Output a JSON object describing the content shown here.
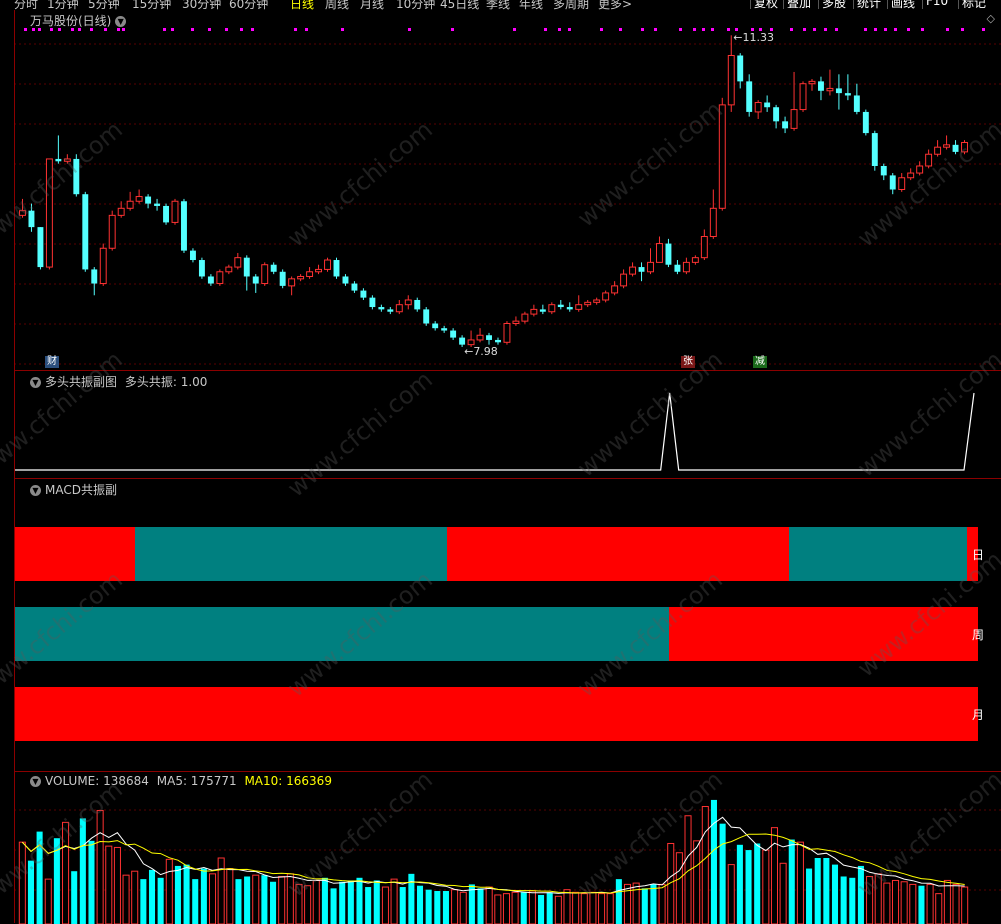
{
  "toolbar": {
    "tabs": [
      {
        "label": "分时",
        "active": false
      },
      {
        "label": "1分钟",
        "active": false
      },
      {
        "label": "5分钟",
        "active": false
      },
      {
        "label": "15分钟",
        "active": false
      },
      {
        "label": "30分钟",
        "active": false
      },
      {
        "label": "60分钟",
        "active": false
      },
      {
        "label": "日线",
        "active": true
      },
      {
        "label": "周线",
        "active": false
      },
      {
        "label": "月线",
        "active": false
      },
      {
        "label": "10分钟",
        "active": false
      },
      {
        "label": "45日线",
        "active": false
      },
      {
        "label": "季线",
        "active": false
      },
      {
        "label": "年线",
        "active": false
      },
      {
        "label": "多周期",
        "active": false
      },
      {
        "label": "更多>",
        "active": false
      }
    ],
    "right_buttons": [
      "复权",
      "叠加",
      "多股",
      "统计",
      "画线",
      "F10",
      "标记"
    ]
  },
  "main_chart": {
    "title": "万马股份(日线)",
    "high_label": "11.33",
    "low_label": "7.98",
    "markers": {
      "cai": "财",
      "zhang": "张",
      "jian": "减"
    },
    "colors": {
      "up": "#ff3232",
      "down": "#54ffff"
    },
    "candles": [
      [
        7.5,
        7.6,
        7.85,
        7.45
      ],
      [
        7.6,
        7.25,
        7.75,
        7.15
      ],
      [
        7.25,
        6.4,
        7.25,
        6.35
      ],
      [
        6.4,
        8.7,
        8.7,
        6.35
      ],
      [
        8.7,
        8.65,
        9.2,
        8.6
      ],
      [
        8.65,
        8.7,
        8.8,
        8.6
      ],
      [
        8.7,
        7.95,
        8.8,
        7.9
      ],
      [
        7.95,
        6.35,
        8.0,
        6.3
      ],
      [
        6.35,
        6.05,
        6.4,
        5.8
      ],
      [
        6.05,
        6.8,
        6.9,
        6.0
      ],
      [
        6.8,
        7.5,
        7.6,
        6.75
      ],
      [
        7.5,
        7.65,
        7.8,
        7.45
      ],
      [
        7.65,
        7.8,
        8.0,
        7.6
      ],
      [
        7.8,
        7.9,
        8.05,
        7.75
      ],
      [
        7.9,
        7.75,
        7.95,
        7.65
      ],
      [
        7.75,
        7.7,
        7.85,
        7.6
      ],
      [
        7.7,
        7.35,
        7.75,
        7.3
      ],
      [
        7.35,
        7.8,
        7.85,
        7.3
      ],
      [
        7.8,
        6.75,
        7.85,
        6.7
      ],
      [
        6.75,
        6.55,
        6.8,
        6.5
      ],
      [
        6.55,
        6.2,
        6.6,
        6.15
      ],
      [
        6.2,
        6.05,
        6.25,
        6.0
      ],
      [
        6.05,
        6.3,
        6.35,
        6.0
      ],
      [
        6.3,
        6.4,
        6.45,
        6.25
      ],
      [
        6.4,
        6.6,
        6.7,
        6.35
      ],
      [
        6.6,
        6.2,
        6.65,
        5.9
      ],
      [
        6.2,
        6.05,
        6.25,
        5.85
      ],
      [
        6.05,
        6.45,
        6.5,
        6.0
      ],
      [
        6.45,
        6.3,
        6.5,
        6.25
      ],
      [
        6.3,
        6.0,
        6.35,
        5.95
      ],
      [
        6.0,
        6.15,
        6.2,
        5.8
      ],
      [
        6.15,
        6.2,
        6.25,
        6.1
      ],
      [
        6.2,
        6.3,
        6.4,
        6.15
      ],
      [
        6.3,
        6.35,
        6.45,
        6.25
      ],
      [
        6.35,
        6.55,
        6.6,
        6.3
      ],
      [
        6.55,
        6.2,
        6.6,
        6.15
      ],
      [
        6.2,
        6.05,
        6.25,
        6.0
      ],
      [
        6.05,
        5.9,
        6.1,
        5.85
      ],
      [
        5.9,
        5.75,
        5.95,
        5.7
      ],
      [
        5.75,
        5.55,
        5.8,
        5.5
      ],
      [
        5.55,
        5.5,
        5.6,
        5.45
      ],
      [
        5.5,
        5.45,
        5.55,
        5.4
      ],
      [
        5.45,
        5.6,
        5.7,
        5.4
      ],
      [
        5.6,
        5.7,
        5.8,
        5.5
      ],
      [
        5.7,
        5.5,
        5.75,
        5.45
      ],
      [
        5.5,
        5.2,
        5.55,
        5.15
      ],
      [
        5.2,
        5.1,
        5.25,
        5.05
      ],
      [
        5.1,
        5.05,
        5.15,
        5.0
      ],
      [
        5.05,
        4.9,
        5.1,
        4.85
      ],
      [
        4.9,
        4.75,
        4.95,
        4.7
      ],
      [
        4.75,
        4.85,
        5.05,
        4.7
      ],
      [
        4.85,
        4.95,
        5.1,
        4.8
      ],
      [
        4.95,
        4.85,
        5.0,
        4.75
      ],
      [
        4.85,
        4.8,
        4.9,
        4.75
      ],
      [
        4.8,
        5.2,
        5.25,
        4.75
      ],
      [
        5.2,
        5.25,
        5.35,
        5.15
      ],
      [
        5.25,
        5.4,
        5.45,
        5.2
      ],
      [
        5.4,
        5.5,
        5.6,
        5.35
      ],
      [
        5.5,
        5.45,
        5.6,
        5.4
      ],
      [
        5.45,
        5.6,
        5.65,
        5.4
      ],
      [
        5.6,
        5.55,
        5.7,
        5.5
      ],
      [
        5.55,
        5.5,
        5.65,
        5.45
      ],
      [
        5.5,
        5.6,
        5.8,
        5.45
      ],
      [
        5.6,
        5.65,
        5.7,
        5.55
      ],
      [
        5.65,
        5.7,
        5.75,
        5.6
      ],
      [
        5.7,
        5.85,
        5.9,
        5.65
      ],
      [
        5.85,
        6.0,
        6.1,
        5.8
      ],
      [
        6.0,
        6.25,
        6.35,
        5.95
      ],
      [
        6.25,
        6.4,
        6.5,
        6.2
      ],
      [
        6.4,
        6.3,
        6.5,
        6.1
      ],
      [
        6.3,
        6.5,
        6.8,
        6.25
      ],
      [
        6.5,
        6.9,
        7.05,
        6.5
      ],
      [
        6.9,
        6.45,
        7.0,
        6.4
      ],
      [
        6.45,
        6.3,
        6.55,
        6.25
      ],
      [
        6.3,
        6.5,
        6.6,
        6.25
      ],
      [
        6.5,
        6.6,
        6.65,
        6.45
      ],
      [
        6.6,
        7.05,
        7.2,
        6.55
      ],
      [
        7.05,
        7.65,
        8.05,
        7.0
      ],
      [
        7.65,
        9.85,
        10.0,
        7.6
      ],
      [
        9.85,
        10.9,
        11.33,
        9.7
      ],
      [
        10.9,
        10.35,
        10.95,
        10.2
      ],
      [
        10.35,
        9.7,
        10.5,
        9.6
      ],
      [
        9.7,
        9.9,
        9.95,
        9.55
      ],
      [
        9.9,
        9.8,
        10.05,
        9.7
      ],
      [
        9.8,
        9.5,
        9.85,
        9.35
      ],
      [
        9.5,
        9.35,
        9.6,
        9.25
      ],
      [
        9.35,
        9.75,
        10.55,
        9.3
      ],
      [
        9.75,
        10.3,
        10.35,
        9.7
      ],
      [
        10.3,
        10.35,
        10.4,
        10.15
      ],
      [
        10.35,
        10.15,
        10.45,
        9.95
      ],
      [
        10.15,
        10.2,
        10.6,
        10.05
      ],
      [
        10.2,
        10.1,
        10.5,
        9.75
      ],
      [
        10.1,
        10.05,
        10.5,
        9.95
      ],
      [
        10.05,
        9.7,
        10.3,
        9.65
      ],
      [
        9.7,
        9.25,
        9.75,
        9.2
      ],
      [
        9.25,
        8.55,
        9.3,
        8.45
      ],
      [
        8.55,
        8.35,
        8.6,
        8.25
      ],
      [
        8.35,
        8.05,
        8.4,
        7.95
      ],
      [
        8.05,
        8.3,
        8.4,
        8.0
      ],
      [
        8.3,
        8.4,
        8.5,
        8.25
      ],
      [
        8.4,
        8.55,
        8.65,
        8.35
      ],
      [
        8.55,
        8.8,
        8.9,
        8.5
      ],
      [
        8.8,
        8.95,
        9.1,
        8.75
      ],
      [
        8.95,
        9.0,
        9.2,
        8.9
      ],
      [
        9.0,
        8.85,
        9.1,
        8.8
      ],
      [
        8.85,
        9.05,
        9.1,
        8.8
      ]
    ]
  },
  "resonance_panel": {
    "title": "多头共振副图",
    "value_label": "多头共振: 1.00",
    "spikes": [
      {
        "center": 0.683
      },
      {
        "center": 1.0
      }
    ]
  },
  "macd_panel": {
    "title": "MACD共振副",
    "rows": [
      {
        "label": "日",
        "segments": [
          {
            "start": 0.0,
            "end": 0.125,
            "state": "red"
          },
          {
            "start": 0.125,
            "end": 0.449,
            "state": "teal"
          },
          {
            "start": 0.449,
            "end": 0.804,
            "state": "red"
          },
          {
            "start": 0.804,
            "end": 0.989,
            "state": "teal"
          },
          {
            "start": 0.989,
            "end": 1.0,
            "state": "red"
          }
        ]
      },
      {
        "label": "周",
        "segments": [
          {
            "start": 0.0,
            "end": 0.679,
            "state": "teal"
          },
          {
            "start": 0.679,
            "end": 1.0,
            "state": "red"
          }
        ]
      },
      {
        "label": "月",
        "segments": [
          {
            "start": 0.0,
            "end": 1.0,
            "state": "red"
          }
        ]
      }
    ],
    "colors": {
      "red": "#ff0000",
      "teal": "#008080"
    }
  },
  "volume_panel": {
    "volume_label": "VOLUME: 138684",
    "ma5_label": "MA5: 175771",
    "ma10_label": "MA10: 166369",
    "colors": {
      "ma5": "#ffffff",
      "ma10": "#ffff00"
    },
    "volumes": [
      62,
      48,
      70,
      34,
      65,
      77,
      40,
      80,
      63,
      86,
      59,
      58,
      37,
      40,
      34,
      41,
      35,
      49,
      44,
      45,
      34,
      42,
      38,
      50,
      42,
      34,
      36,
      37,
      37,
      32,
      36,
      38,
      30,
      29,
      33,
      35,
      27,
      32,
      33,
      35,
      28,
      33,
      28,
      34,
      28,
      38,
      29,
      26,
      25,
      25,
      26,
      24,
      30,
      27,
      28,
      22,
      23,
      24,
      24,
      25,
      22,
      24,
      21,
      26,
      24,
      23,
      24,
      23,
      23,
      34,
      30,
      31,
      27,
      30,
      30,
      61,
      54,
      82,
      63,
      89,
      94,
      76,
      45,
      60,
      56,
      61,
      56,
      73,
      46,
      64,
      62,
      42,
      50,
      50,
      45,
      36,
      35,
      44,
      36,
      38,
      31,
      33,
      32,
      30,
      29,
      30,
      23,
      33,
      30,
      28
    ]
  },
  "watermark": "www.cfchi.com"
}
